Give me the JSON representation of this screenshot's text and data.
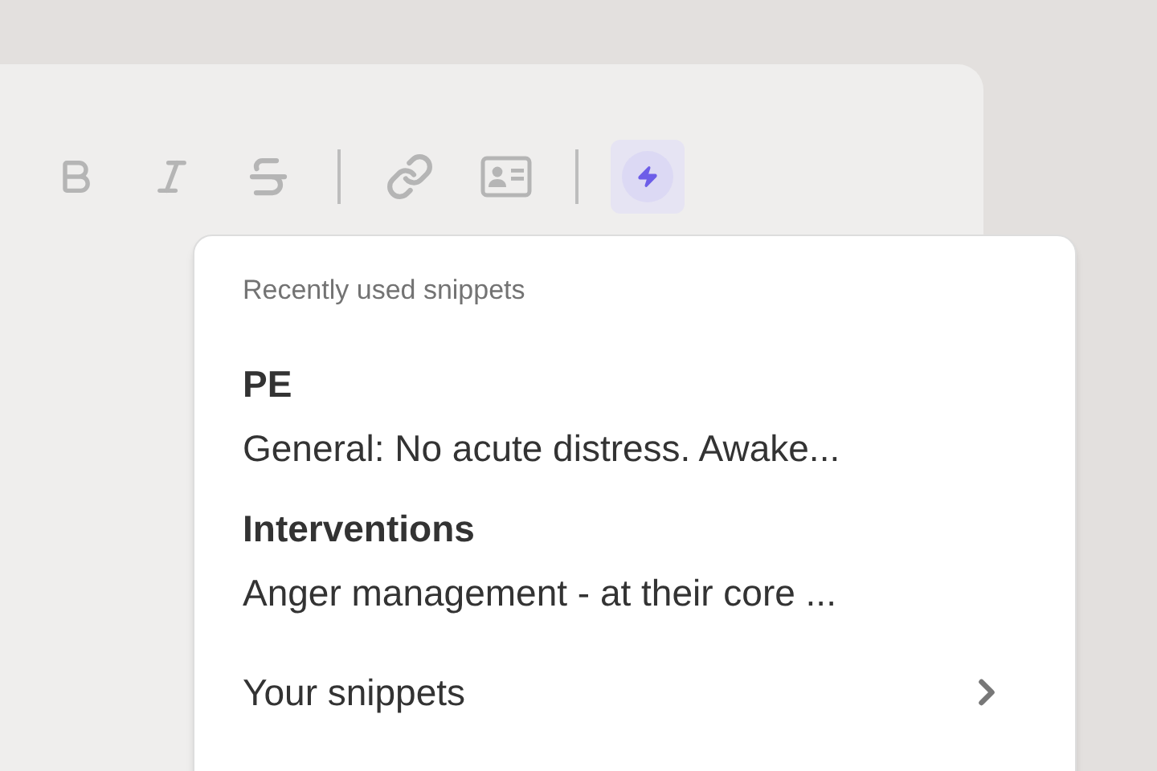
{
  "toolbar": [
    {
      "kind": "bold",
      "selected": false
    },
    {
      "kind": "italic",
      "selected": false
    },
    {
      "kind": "strikethrough",
      "selected": false
    },
    {
      "kind": "divider"
    },
    {
      "kind": "link",
      "selected": false
    },
    {
      "kind": "contact",
      "selected": false
    },
    {
      "kind": "divider"
    },
    {
      "kind": "snippet",
      "selected": true
    }
  ],
  "popup": {
    "heading": "Recently used snippets",
    "snippets": [
      {
        "title": "PE",
        "preview": "General: No acute distress. Awake..."
      },
      {
        "title": "Interventions",
        "preview": "Anger management - at their core ..."
      }
    ],
    "footer": "Your snippets"
  }
}
